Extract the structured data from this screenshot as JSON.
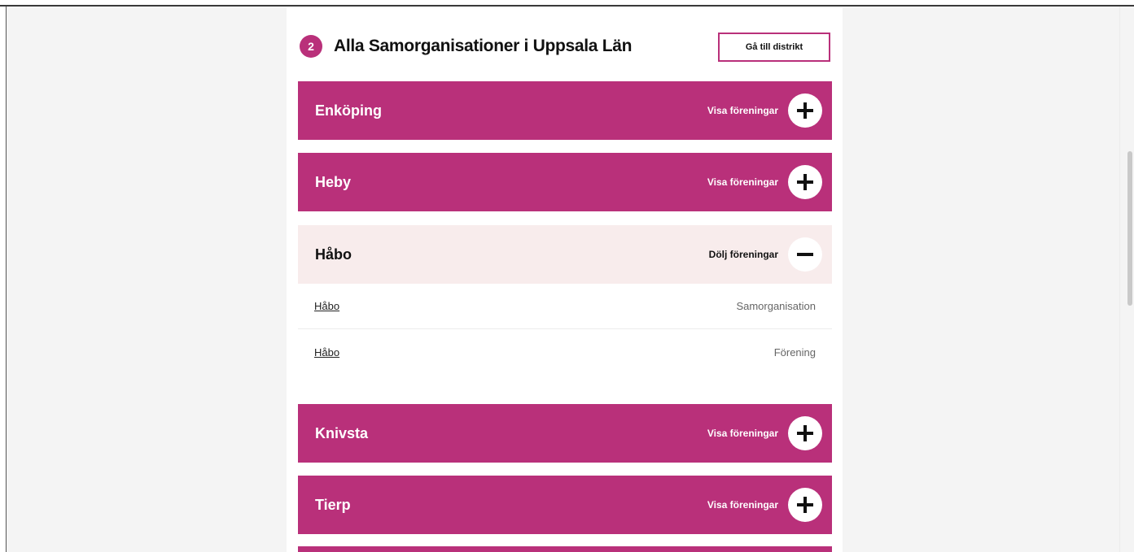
{
  "header": {
    "step_number": "2",
    "title": "Alla Samorganisationer i Uppsala Län",
    "district_button_label": "Gå till distrikt"
  },
  "groups": [
    {
      "name": "Enköping",
      "action_label": "Visa föreningar",
      "expanded": false
    },
    {
      "name": "Heby",
      "action_label": "Visa föreningar",
      "expanded": false
    },
    {
      "name": "Håbo",
      "action_label": "Dölj föreningar",
      "expanded": true,
      "items": [
        {
          "name": "Håbo",
          "type": "Samorganisation"
        },
        {
          "name": "Håbo",
          "type": "Förening"
        }
      ]
    },
    {
      "name": "Knivsta",
      "action_label": "Visa föreningar",
      "expanded": false
    },
    {
      "name": "Tierp",
      "action_label": "Visa föreningar",
      "expanded": false
    }
  ],
  "colors": {
    "accent": "#b9307a",
    "open_background": "#f8ecec",
    "page_background": "#f4f4f4"
  },
  "icons": {
    "expand": "plus-icon",
    "collapse": "minus-icon"
  }
}
